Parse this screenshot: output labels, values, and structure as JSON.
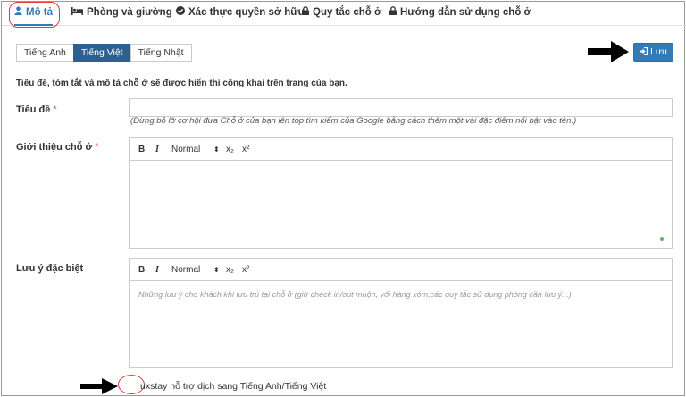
{
  "tabs": [
    {
      "label": "Mô tả",
      "icon": "user-icon",
      "active": true
    },
    {
      "label": "Phòng và giường",
      "icon": "bed-icon"
    },
    {
      "label": "Xác thực quyền sở hữu",
      "icon": "check-circle-icon"
    },
    {
      "label": "Quy tắc chỗ ở",
      "icon": "lock-icon"
    },
    {
      "label": "Hướng dẫn sử dụng chỗ ở",
      "icon": "lock-icon"
    }
  ],
  "languages": [
    {
      "label": "Tiếng Anh"
    },
    {
      "label": "Tiếng Việt",
      "active": true
    },
    {
      "label": "Tiếng Nhật"
    }
  ],
  "save_label": "Lưu",
  "intro": "Tiêu đề, tóm tắt và mô tả chỗ ở sẽ được hiển thị công khai trên trang của bạn.",
  "title_field": {
    "label": "Tiêu đề",
    "required_mark": "*",
    "value": "",
    "hint": "(Đừng bỏ lỡ cơ hội đưa Chỗ ở của bạn lên top tìm kiếm của Google bằng cách thêm một vài đặc điểm nổi bật vào tên.)"
  },
  "intro_field": {
    "label": "Giới thiệu chỗ ở",
    "required_mark": "*"
  },
  "notes_field": {
    "label": "Lưu ý đặc biệt",
    "placeholder": "Những lưu ý cho khách khi lưu trú tại chỗ ở (giờ check in/out muộn, vối hàng xóm,các quy tắc sử dụng phòng cần lưu ý...)"
  },
  "editor_toolbar": {
    "bold": "B",
    "italic": "I",
    "format": "Normal",
    "format_arrow": "⬍",
    "subscript": "x₂",
    "superscript": "x²"
  },
  "translate_note": "uxstay hỗ trợ dịch sang Tiếng Anh/Tiếng Việt",
  "colors": {
    "accent": "#337ab7",
    "active_lang": "#2e5f8f",
    "annotation_red": "#e53935",
    "required": "#d9534f"
  }
}
